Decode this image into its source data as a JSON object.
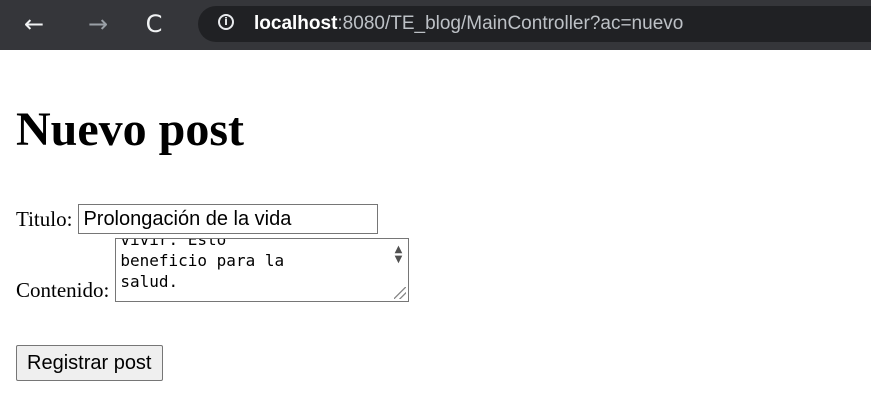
{
  "browser": {
    "back_icon": "←",
    "forward_icon": "→",
    "reload_icon": "C",
    "info_icon": "i",
    "url_host": "localhost",
    "url_rest": ":8080/TE_blog/MainController?ac=nuevo"
  },
  "page": {
    "heading": "Nuevo post",
    "form": {
      "title_label": "Titulo:",
      "title_value": "Prolongación de la vida",
      "content_label": "Contenido:",
      "content_lines": [
        "vivir. Esto",
        "beneficio para la",
        "salud."
      ],
      "submit_label": "Registrar post"
    }
  }
}
